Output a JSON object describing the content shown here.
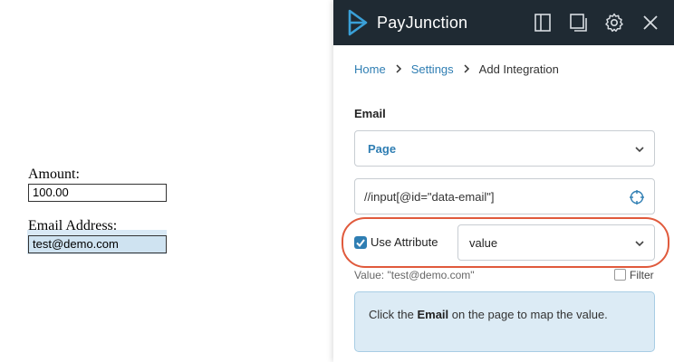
{
  "host_page": {
    "amount_label": "Amount:",
    "amount_value": "100.00",
    "email_label": "Email Address:",
    "email_value": "test@demo.com"
  },
  "panel": {
    "brand": "PayJunction",
    "toolbar_icons": [
      "dock-icon",
      "popout-icon",
      "gear-icon",
      "close-icon"
    ],
    "breadcrumb": {
      "home": "Home",
      "settings": "Settings",
      "current": "Add Integration"
    },
    "field_label": "Email",
    "source_select": {
      "selected": "Page"
    },
    "xpath_input": {
      "value": "//input[@id=\"data-email\"]"
    },
    "use_attribute": {
      "label": "Use Attribute",
      "checked": true
    },
    "attribute_select": {
      "selected": "value"
    },
    "value_preview": "Value: \"test@demo.com\"",
    "filter": {
      "label": "Filter",
      "checked": false
    },
    "hint": {
      "prefix": "Click the ",
      "field": "Email",
      "suffix": " on the page to map the value."
    }
  },
  "colors": {
    "topbar": "#1f2a33",
    "accent": "#2f7eb3",
    "highlight_ring": "#e05a3c",
    "hint_bg": "#dcebf5"
  }
}
